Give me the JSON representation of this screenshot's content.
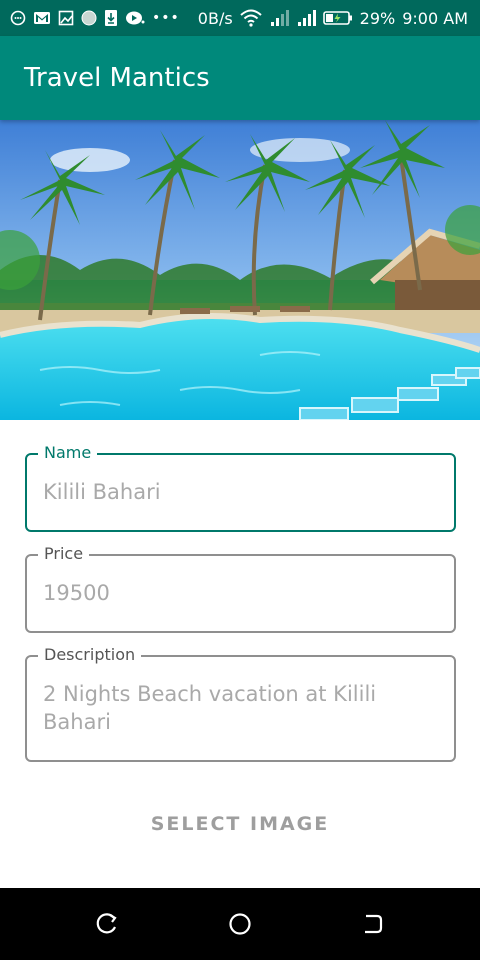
{
  "status_bar": {
    "net_speed": "0B/s",
    "battery": "29%",
    "time": "9:00 AM",
    "icons": [
      "circle-dots-icon",
      "gmail-icon",
      "image-icon",
      "globe-icon",
      "download-icon",
      "play-icon",
      "more-dots-icon",
      "wifi-icon",
      "signal-icon",
      "signal-icon",
      "battery-icon"
    ]
  },
  "app_bar": {
    "title": "Travel Mantics"
  },
  "hero": {
    "image_description_icon": "beach-resort-pool-image"
  },
  "form": {
    "name": {
      "label": "Name",
      "value": "Kilili Bahari"
    },
    "price": {
      "label": "Price",
      "value": "19500"
    },
    "description": {
      "label": "Description",
      "value": "2 Nights Beach vacation at Kilili Bahari"
    }
  },
  "select_image_label": "SELECT IMAGE",
  "nav_bar": {
    "buttons": [
      "back-icon",
      "home-icon",
      "recents-icon"
    ]
  },
  "colors": {
    "status_bar": "#00695c",
    "app_bar": "#00897b",
    "accent": "#00796b"
  }
}
